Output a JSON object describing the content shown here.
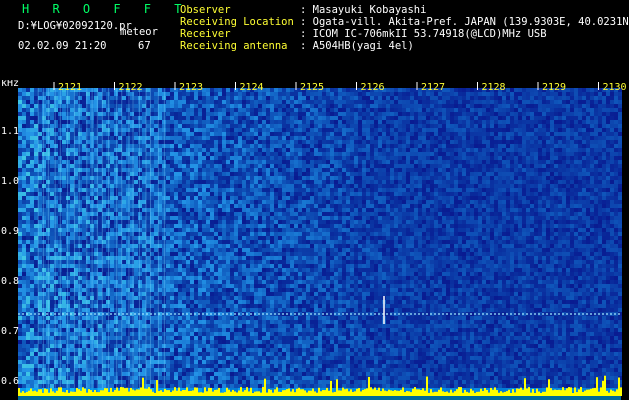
{
  "app": {
    "title": "H R O F F T",
    "file_path": "D:¥LOG¥02092120.pr",
    "mode": "meteor",
    "datetime": "02.02.09 21:20",
    "count": "67"
  },
  "info": [
    {
      "label": "Observer",
      "value": ": Masayuki Kobayashi"
    },
    {
      "label": "Receiving Location",
      "value": ": Ogata-vill. Akita-Pref. JAPAN (139.9303E, 40.0231N)"
    },
    {
      "label": "Receiver",
      "value": ": ICOM IC-706mkII 53.74918(@LCD)MHz USB"
    },
    {
      "label": "Receiving antenna",
      "value": ": A504HB(yagi 4el)"
    }
  ],
  "spectrogram": {
    "y_unit": "kHz",
    "y_ticks": [
      "1.1",
      "1.0",
      "0.9",
      "0.8",
      "0.7",
      "0.6"
    ],
    "x_ticks": [
      "2121",
      "2122",
      "2123",
      "2124",
      "2125",
      "2126",
      "2127",
      "2128",
      "2129",
      "2130"
    ],
    "colors": {
      "background": "#000000",
      "noise_low": "#0a1a8a",
      "noise_high": "#3fd0ff",
      "signal": "#ffffff",
      "baseline": "#ffff00",
      "tick_label": "#ffff33",
      "axis_label": "#ffffff"
    }
  }
}
